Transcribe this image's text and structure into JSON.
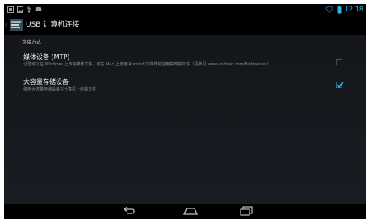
{
  "window": {
    "title": "USB 计算机连接",
    "clock": "12:18"
  },
  "colors": {
    "accent": "#33b5e5",
    "background": "#15181d"
  },
  "icons": {
    "status_left": [
      "screenshot-icon",
      "image-icon",
      "usb-icon",
      "game-controller-icon"
    ],
    "status_right": [
      "wifi-icon",
      "battery-icon"
    ],
    "navigation": [
      "back-icon",
      "home-icon",
      "recent-apps-icon"
    ]
  },
  "settings": {
    "section_header": "连接方式",
    "options": [
      {
        "title": "媒体设备 (MTP)",
        "summary": "让您可以在 Windows 上传输媒体文件，或在 Mac 上使用 Android 文件传输应用来传输文件（请参见 www.android.com/filetransfer）",
        "checked": false
      },
      {
        "title": "大容量存储设备",
        "summary": "使用大容量存储设备在计算机上传输文件",
        "checked": true
      }
    ]
  }
}
